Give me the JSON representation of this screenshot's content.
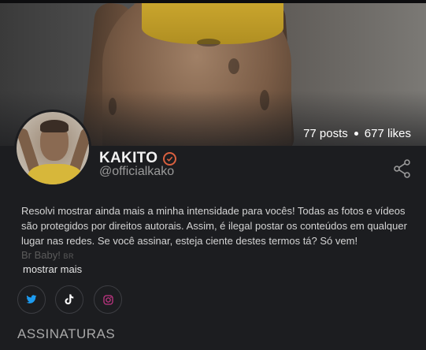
{
  "profile": {
    "name": "KAKITO",
    "handle": "@officialkako",
    "posts": "77 posts",
    "likes": "677 likes",
    "bio": "Resolvi mostrar ainda mais a minha intensidade para vocês! Todas as fotos e vídeos são protegidos por direitos autorais. Assim, é ilegal postar os conteúdos em qualquer lugar nas redes. Se você assinar, esteja ciente destes termos tá? Só vem!",
    "bio_tail": "Br Baby!",
    "bio_flag": "BR",
    "show_more": "mostrar mais"
  },
  "social": [
    {
      "network": "twitter",
      "icon": "twitter-icon",
      "color": "#1d9bf0"
    },
    {
      "network": "tiktok",
      "icon": "tiktok-icon",
      "color": "#ffffff"
    },
    {
      "network": "instagram",
      "icon": "instagram-icon",
      "color": "#c13584"
    }
  ],
  "sections": {
    "subscriptions": "ASSINATURAS"
  },
  "colors": {
    "background": "#1c1d20",
    "verified": "#d9603f",
    "shirt": "#d7b73a"
  }
}
